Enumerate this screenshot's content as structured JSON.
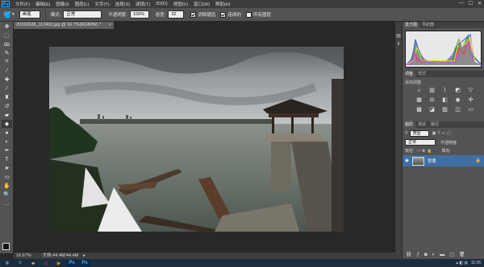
{
  "menubar": {
    "logo": "Ps",
    "items": [
      "文件(F)",
      "编辑(E)",
      "图像(I)",
      "图层(L)",
      "文字(Y)",
      "选择(S)",
      "滤镜(T)",
      "3D(D)",
      "视图(V)",
      "窗口(W)",
      "帮助(H)"
    ],
    "window_controls": [
      "—",
      "☐",
      "✕"
    ]
  },
  "options": {
    "mode_label": "模式:",
    "mode_value": "正常",
    "brush_preset": "画笔",
    "opacity_label": "不透明度:",
    "opacity_value": "100%",
    "tolerance_label": "容差:",
    "tolerance_value": "32",
    "antialias_label": "消除锯齿",
    "contiguous_label": "连续的",
    "all_layers_label": "所有图层"
  },
  "document": {
    "tab_title": "20150628_112402.jpg @ 16.7%(RGB/8#) *",
    "close": "×"
  },
  "status": {
    "zoom": "16.67%",
    "doc_info": "文档:44.4M/44.4M"
  },
  "panels": {
    "histogram_tabs": [
      "直方图",
      "导航器"
    ],
    "adjustments_tabs": [
      "调整",
      "样式"
    ],
    "add_adjustment_label": "添加调整",
    "layers_tabs": [
      "图层",
      "通道",
      "路径"
    ],
    "layer_kind": "类型",
    "blend_mode": "正常",
    "opacity_label": "不透明度:",
    "lock_label": "锁定:",
    "fill_label": "填充:",
    "layer_name": "背景"
  },
  "taskbar": {
    "time": "11:26",
    "date": "2015/6/28"
  },
  "colors": {
    "accent": "#31a8ff",
    "selected_layer": "#3f6ea3"
  }
}
